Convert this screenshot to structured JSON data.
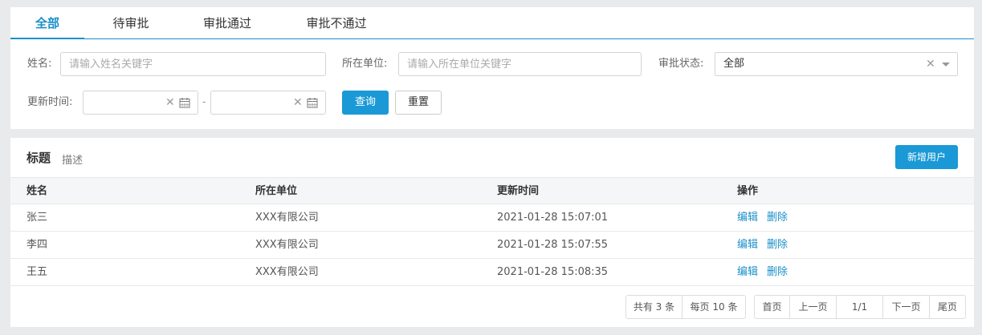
{
  "tabs": [
    "全部",
    "待审批",
    "审批通过",
    "审批不通过"
  ],
  "filters": {
    "name_label": "姓名:",
    "name_placeholder": "请输入姓名关键字",
    "org_label": "所在单位:",
    "org_placeholder": "请输入所在单位关键字",
    "status_label": "审批状态:",
    "status_value": "全部",
    "updated_label": "更新时间:",
    "date_separator": "-",
    "query_label": "查询",
    "reset_label": "重置"
  },
  "list": {
    "title": "标题",
    "description": "描述",
    "add_label": "新增用户"
  },
  "table": {
    "columns": [
      "姓名",
      "所在单位",
      "更新时间",
      "操作"
    ],
    "rows": [
      {
        "name": "张三",
        "org": "XXX有限公司",
        "updated": "2021-01-28 15:07:01"
      },
      {
        "name": "李四",
        "org": "XXX有限公司",
        "updated": "2021-01-28 15:07:55"
      },
      {
        "name": "王五",
        "org": "XXX有限公司",
        "updated": "2021-01-28 15:08:35"
      }
    ],
    "edit_label": "编辑",
    "delete_label": "删除"
  },
  "pager": {
    "total": "共有 3 条",
    "per_page": "每页 10 条",
    "first": "首页",
    "prev": "上一页",
    "current": "1/1",
    "next": "下一页",
    "last": "尾页"
  },
  "colors": {
    "accent": "#1a8fc9",
    "primary_button": "#1a99d6",
    "background": "#e9eaec"
  },
  "icons": [
    "clear-icon",
    "dropdown-caret-icon",
    "calendar-icon"
  ]
}
